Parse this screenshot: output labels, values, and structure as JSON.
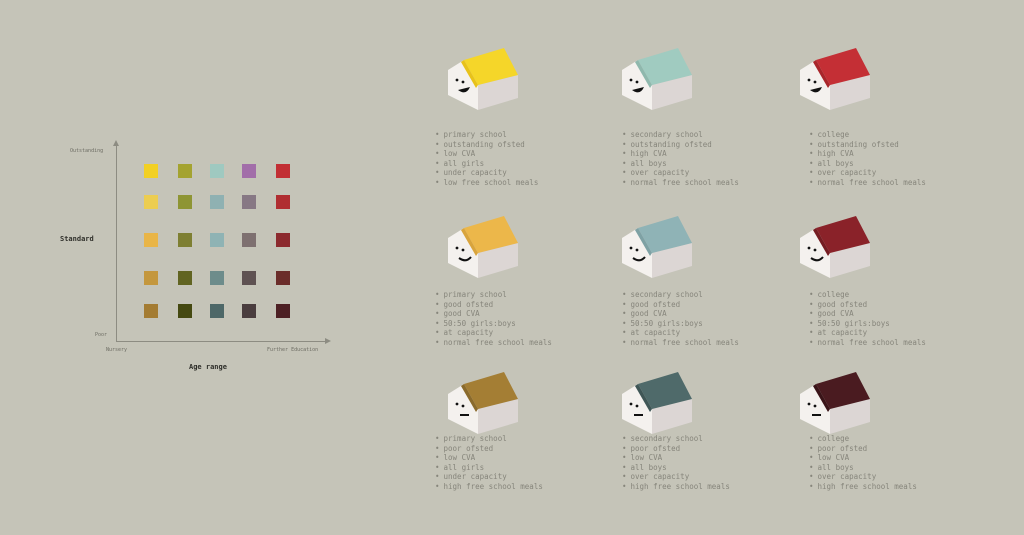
{
  "matrix": {
    "y_title": "Standard",
    "x_title": "Age range",
    "y_top_label": "Outstanding",
    "y_bottom_label": "Poor",
    "x_left_label": "Nursery",
    "x_right_label": "Further Education",
    "rows": [
      [
        "#f2d024",
        "#a4a330",
        "#9fc9c0",
        "#a26ea9",
        "#c22f34"
      ],
      [
        "#eccd51",
        "#8e9534",
        "#8fb1b2",
        "#877884",
        "#b02e31"
      ],
      [
        "#e9b547",
        "#7e7f32",
        "#8fb3b4",
        "#7e7070",
        "#8c2a2e"
      ],
      [
        "#c4973d",
        "#616421",
        "#6d8c8b",
        "#5f5252",
        "#6b2d2a"
      ],
      [
        "#a47c32",
        "#454911",
        "#4e6868",
        "#4a3d3e",
        "#4d2024"
      ]
    ]
  },
  "schools": [
    {
      "roof": "#f5d629",
      "roof_side": "#e8c21a",
      "face": "open",
      "items": [
        "primary school",
        "outstanding ofsted",
        "low CVA",
        "all girls",
        "under capacity",
        "low free school meals"
      ]
    },
    {
      "roof": "#a0cbc0",
      "roof_side": "#8fb8ad",
      "face": "open",
      "items": [
        "secondary school",
        "outstanding ofsted",
        "high CVA",
        "all boys",
        "over capacity",
        "normal free school meals"
      ]
    },
    {
      "roof": "#c42f35",
      "roof_side": "#a9262b",
      "face": "open",
      "items": [
        "college",
        "outstanding ofsted",
        "high CVA",
        "all boys",
        "over capacity",
        "normal free school meals"
      ]
    },
    {
      "roof": "#ecb74a",
      "roof_side": "#d9a43c",
      "face": "smile",
      "items": [
        "primary school",
        "good ofsted",
        "good CVA",
        "50:50 girls:boys",
        "at capacity",
        "normal free school meals"
      ]
    },
    {
      "roof": "#8fb3b6",
      "roof_side": "#7ea1a4",
      "face": "smile",
      "items": [
        "secondary school",
        "good ofsted",
        "good CVA",
        "50:50 girls:boys",
        "at capacity",
        "normal free school meals"
      ]
    },
    {
      "roof": "#8a2229",
      "roof_side": "#751c22",
      "face": "smile",
      "items": [
        "college",
        "good ofsted",
        "good CVA",
        "50:50 girls:boys",
        "at capacity",
        "normal free school meals"
      ]
    },
    {
      "roof": "#a47e34",
      "roof_side": "#8a6a2b",
      "face": "flat",
      "items": [
        "primary school",
        "poor ofsted",
        "low CVA",
        "all girls",
        "under capacity",
        "high free school meals"
      ]
    },
    {
      "roof": "#4f6a6a",
      "roof_side": "#3f5656",
      "face": "flat",
      "items": [
        "secondary school",
        "poor ofsted",
        "low CVA",
        "all boys",
        "over capacity",
        "high free school meals"
      ]
    },
    {
      "roof": "#4a1b20",
      "roof_side": "#3a1418",
      "face": "flat",
      "items": [
        "college",
        "poor ofsted",
        "low CVA",
        "all boys",
        "over capacity",
        "high free school meals"
      ]
    }
  ]
}
